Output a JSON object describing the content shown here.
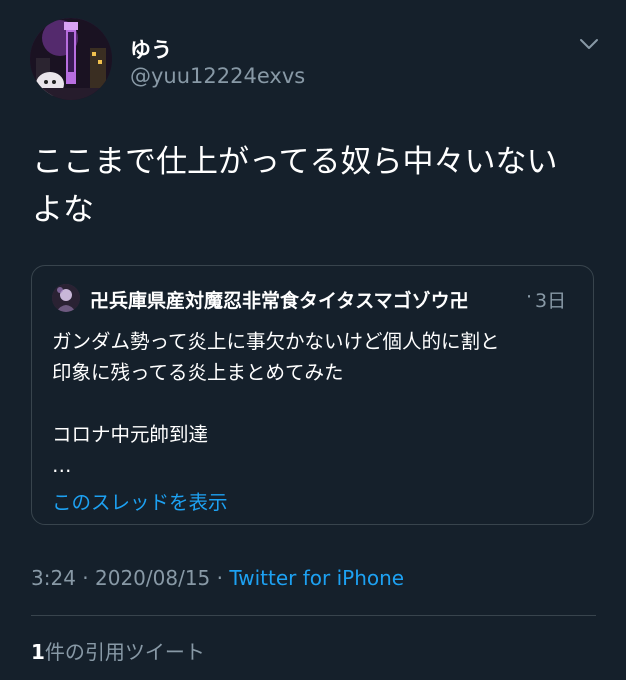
{
  "tweet": {
    "author": {
      "display_name": "ゆう",
      "handle": "@yuu12224exvs",
      "avatar_icon": "user-avatar-icon"
    },
    "more_icon": "chevron-down-icon",
    "text_lines": [
      "ここまで仕上がってる奴ら中々いない",
      "よな"
    ],
    "quoted": {
      "avatar_icon": "quoted-user-avatar-icon",
      "display_name": "卍兵庫県産対魔忍非常食タイタスマゴゾウ卍",
      "separator": "·",
      "time": "3日",
      "body_lines": [
        "ガンダム勢って炎上に事欠かないけど個人的に割と",
        "印象に残ってる炎上まとめてみた",
        "",
        "コロナ中元帥到達",
        "…"
      ],
      "show_thread": "このスレッドを表示"
    },
    "meta": {
      "time": "3:24",
      "sep1": " · ",
      "date": "2020/08/15",
      "sep2": " · ",
      "source": "Twitter for iPhone"
    },
    "quote_count": {
      "number": "1",
      "label": "件の引用ツイート"
    }
  },
  "colors": {
    "background": "#15202b",
    "text": "#ffffff",
    "secondary": "#8899a6",
    "accent": "#1da1f2",
    "border": "#38444d"
  }
}
